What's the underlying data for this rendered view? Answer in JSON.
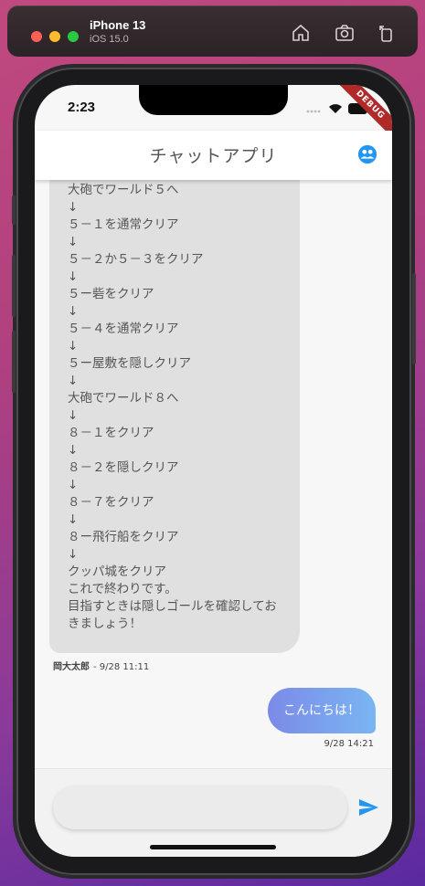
{
  "simulator": {
    "device": "iPhone 13",
    "os": "iOS 15.0"
  },
  "status_bar": {
    "time": "2:23",
    "debug": "DEBUG"
  },
  "appbar": {
    "title": "チャットアプリ"
  },
  "messages": [
    {
      "lines": [
        "大砲でワールド５へ",
        "↓",
        "５－１を通常クリア",
        "↓",
        "５－２か５－３をクリア",
        "↓",
        "５ー砦をクリア",
        "↓",
        "５－４を通常クリア",
        "↓",
        "５ー屋敷を隠しクリア",
        "↓",
        "大砲でワールド８へ",
        "↓",
        "８－１をクリア",
        "↓",
        "８－２を隠しクリア",
        "↓",
        "８－７をクリア",
        "↓",
        "８ー飛行船をクリア",
        "↓",
        "クッパ城をクリア",
        "これで終わりです。",
        "目指すときは隠しゴールを確認してお",
        "きましょう！"
      ],
      "sender": "岡大太郎",
      "time": "- 9/28 11:11"
    },
    {
      "text": "こんにちは！",
      "time": "9/28 14:21"
    }
  ],
  "input": {
    "placeholder": ""
  },
  "colors": {
    "accent": "#2196f3",
    "bubble_other": "#e0e0e0"
  }
}
